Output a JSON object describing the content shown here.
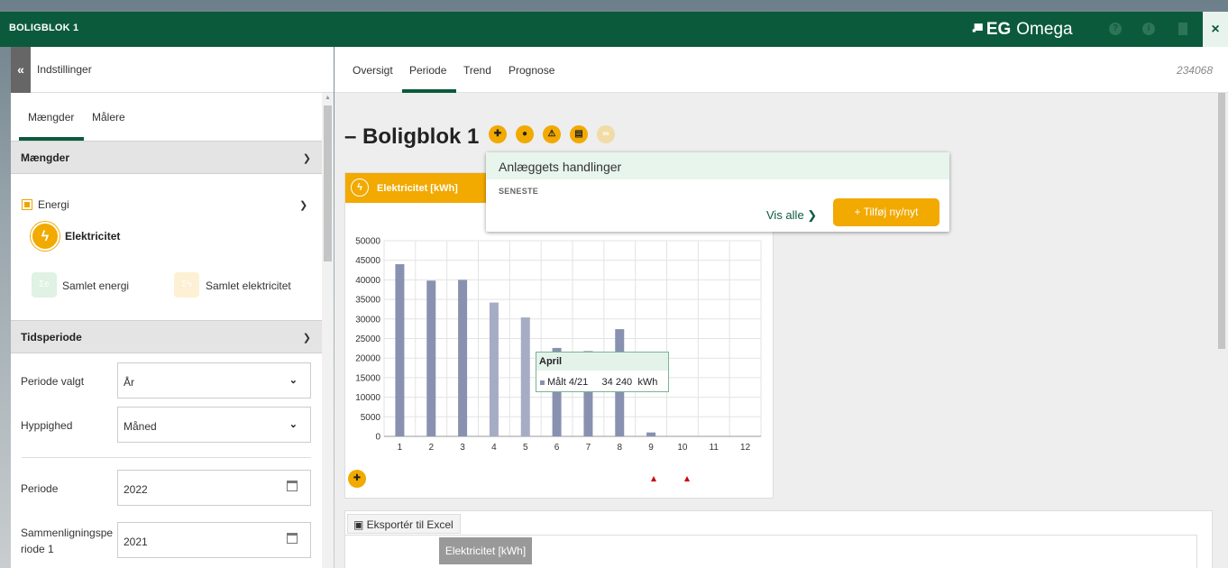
{
  "app": {
    "title": "BOLIGBLOK 1",
    "brand_eg": "EG",
    "brand_name": "Omega",
    "close": "×"
  },
  "sidebar": {
    "collapse": "«",
    "header": "Indstillinger",
    "tabs": [
      {
        "label": "Mængder"
      },
      {
        "label": "Målere"
      }
    ],
    "section_quantities": "Mængder",
    "energy_label": "Energi",
    "electricity_label": "Elektricitet",
    "total_energy": "Samlet energi",
    "total_electricity": "Samlet elektricitet",
    "section_period": "Tidsperiode",
    "period_selected_label": "Periode valgt",
    "period_selected_value": "År",
    "frequency_label": "Hyppighed",
    "frequency_value": "Måned",
    "period_label": "Periode",
    "period_value": "2022",
    "comparison_label": "Sammenligningspe riode 1",
    "comparison_value": "2021"
  },
  "main": {
    "tabs": [
      {
        "label": "Oversigt"
      },
      {
        "label": "Periode"
      },
      {
        "label": "Trend"
      },
      {
        "label": "Prognose"
      }
    ],
    "id_number": "234068",
    "title": "– Boligblok 1",
    "card_title": "Elektricitet [kWh]",
    "popup": {
      "title": "Anlæggets handlinger",
      "subtitle": "SENESTE",
      "see_all": "Vis alle ❯",
      "add": "+ Tilføj ny/nyt"
    },
    "tooltip": {
      "title": "April",
      "series": "Målt 4/21",
      "value": "34 240",
      "unit": "kWh"
    },
    "export": "Eksportér til Excel",
    "table_header": "Elektricitet [kWh]"
  },
  "chart_data": {
    "type": "bar",
    "categories": [
      "1",
      "2",
      "3",
      "4",
      "5",
      "6",
      "7",
      "8",
      "9",
      "10",
      "11",
      "12"
    ],
    "series": [
      {
        "values": [
          44000,
          39800,
          40000,
          34200,
          30400,
          22600,
          21800,
          27400,
          1000,
          0,
          0,
          0
        ]
      }
    ],
    "ylim": [
      0,
      50000
    ],
    "yticks": [
      0,
      5000,
      10000,
      15000,
      20000,
      25000,
      30000,
      35000,
      40000,
      45000,
      50000
    ],
    "grid": true,
    "colors": {
      "bar": "#8891b0",
      "bar_highlight": "#a5acc4"
    }
  },
  "colors": {
    "brand": "#0b5a3c",
    "accent": "#f2a900"
  }
}
